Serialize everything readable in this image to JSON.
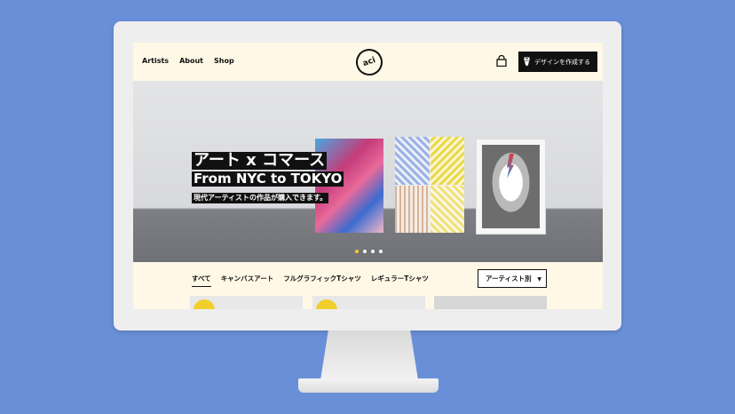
{
  "header": {
    "nav": [
      "Artists",
      "About",
      "Shop"
    ],
    "logo_text": "aci",
    "create_label": "デザインを作成する"
  },
  "hero": {
    "line1": "アート x コマース",
    "line2": "From NYC to TOKYO",
    "line3": "現代アーティストの作品が購入できます。",
    "slides": 4,
    "active_slide": 1
  },
  "filters": {
    "tabs": [
      "すべて",
      "キャンバスアート",
      "フルグラフィックTシャツ",
      "レギュラーTシャツ"
    ],
    "active_tab": 0,
    "select_value": "アーティスト別"
  },
  "colors": {
    "background": "#6a8fd9",
    "screen_bg": "#fff8e6",
    "accent_yellow": "#f1cf2a",
    "button_black": "#111111"
  },
  "icons": [
    "cart-icon",
    "pen-icon",
    "chevron-down-icon"
  ]
}
